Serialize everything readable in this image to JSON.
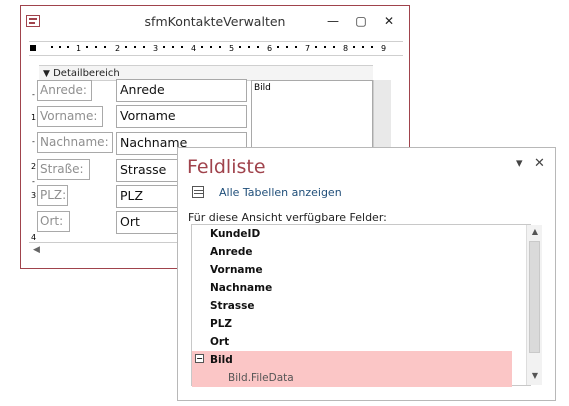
{
  "window": {
    "title": "sfmKontakteVerwalten",
    "controls": {
      "minimize": "—",
      "maximize": "▢",
      "close": "✕"
    }
  },
  "ruler": {
    "numbers": [
      "1",
      "2",
      "3",
      "4",
      "5",
      "6",
      "7",
      "8",
      "9"
    ]
  },
  "vruler": {
    "numbers": [
      "1",
      "2",
      "3",
      "4"
    ]
  },
  "section": {
    "label": "Detailbereich",
    "icon": "section-collapse-icon"
  },
  "form": {
    "labels": [
      "Anrede:",
      "Vorname:",
      "Nachname:",
      "Straße:",
      "PLZ:",
      "Ort:"
    ],
    "fields": [
      "Anrede",
      "Vorname",
      "Nachname",
      "Strasse",
      "PLZ",
      "Ort"
    ],
    "bild_label": "Bild"
  },
  "fieldlist": {
    "title": "Feldliste",
    "show_all_tables": "Alle Tabellen anzeigen",
    "available_label": "Für diese Ansicht verfügbare Felder:",
    "fields": [
      "KundeID",
      "Anrede",
      "Vorname",
      "Nachname",
      "Strasse",
      "PLZ",
      "Ort"
    ],
    "expanded_field": "Bild",
    "expanded_marker": "−",
    "subfield": "Bild.FileData",
    "accent_color": "#a0434c",
    "selection_color": "#fbc6c6"
  }
}
